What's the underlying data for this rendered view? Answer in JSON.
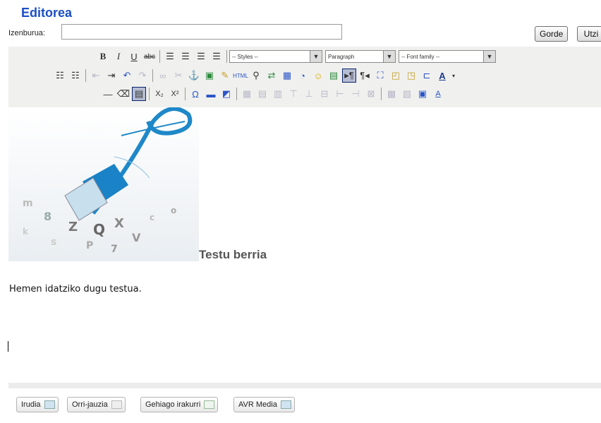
{
  "header": {
    "title": "Editorea"
  },
  "form": {
    "title_label": "Izenburua:",
    "title_value": ""
  },
  "actions": {
    "save_label": "Gorde",
    "cancel_label": "Utzi"
  },
  "toolbar": {
    "styles_select": "-- Styles --",
    "format_select": "Paragraph",
    "font_family_select": "-- Font family --"
  },
  "editor": {
    "heading": "Testu berria",
    "paragraph": "Hemen idatziko dugu testua."
  },
  "footer": {
    "buttons": [
      "Irudia",
      "Orri-jauzia",
      "Gehiago irakurri",
      "AVR Media"
    ]
  }
}
